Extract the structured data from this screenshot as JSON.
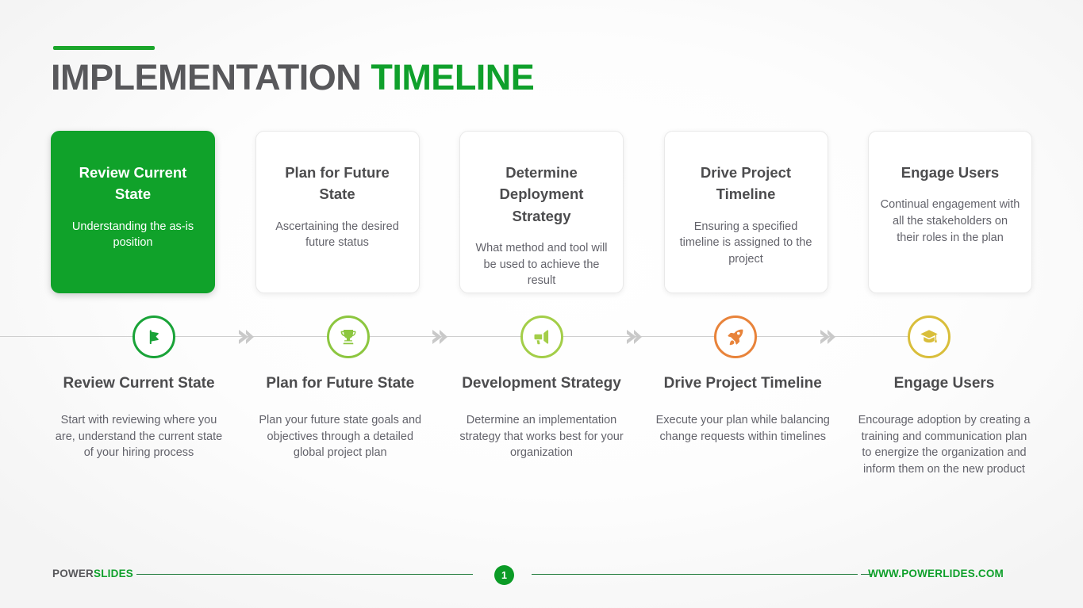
{
  "header": {
    "title_main": "IMPLEMENTATION",
    "title_accent": "TIMELINE"
  },
  "cards": [
    {
      "title": "Review Current State",
      "desc": "Understanding the as-is position",
      "active": true
    },
    {
      "title": "Plan for Future State",
      "desc": "Ascertaining the desired future status",
      "active": false
    },
    {
      "title": "Determine Deployment Strategy",
      "desc": "What method and tool will be used to achieve the result",
      "active": false
    },
    {
      "title": "Drive Project Timeline",
      "desc": "Ensuring a specified timeline is assigned to the project",
      "active": false
    },
    {
      "title": "Engage Users",
      "desc": "Continual engagement with all the stakeholders on their roles in the plan",
      "active": false
    }
  ],
  "timeline": {
    "nodes": [
      {
        "icon": "flag-icon",
        "color": "#19A338"
      },
      {
        "icon": "trophy-icon",
        "color": "#8CC63F"
      },
      {
        "icon": "megaphone-icon",
        "color": "#A3CE48"
      },
      {
        "icon": "rocket-icon",
        "color": "#E8833A"
      },
      {
        "icon": "graduation-cap-icon",
        "color": "#D9BE3B"
      }
    ],
    "arrow_color": "#C9C9C9",
    "line_color": "#CFCFCF"
  },
  "steps": [
    {
      "title": "Review Current State",
      "desc": "Start with reviewing where you are, understand the current state of your hiring process"
    },
    {
      "title": "Plan for Future State",
      "desc": "Plan your future state goals and objectives through a detailed global project plan"
    },
    {
      "title": "Development Strategy",
      "desc": "Determine an implementation strategy that works best for your organization"
    },
    {
      "title": "Drive Project Timeline",
      "desc": "Execute your plan while balancing change requests within timelines"
    },
    {
      "title": "Engage Users",
      "desc": "Encourage adoption by creating a training and communication plan to energize the organization and inform them on the new product"
    }
  ],
  "footer": {
    "brand_dark": "POWER",
    "brand_green": "SLIDES",
    "page_number": "1",
    "website": "WWW.POWERLIDES.COM"
  },
  "colors": {
    "brand_green": "#0FA02B",
    "active_card_green": "#10A22A",
    "title_gray": "#58585B",
    "footer_line": "#1F7A3A"
  }
}
